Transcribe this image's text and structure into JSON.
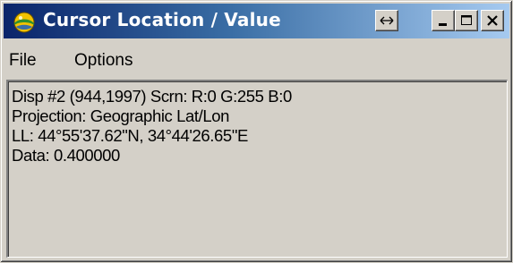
{
  "window": {
    "title": "Cursor Location / Value",
    "app_icon": "envi-globe-icon",
    "controls": {
      "resize_icon": "horizontal-resize-icon",
      "minimize_icon": "minimize-icon",
      "maximize_icon": "maximize-icon",
      "close_icon": "close-icon"
    }
  },
  "menu": {
    "items": [
      {
        "label": "File"
      },
      {
        "label": "Options"
      }
    ]
  },
  "info": {
    "lines": [
      "Disp #2 (944,1997) Scrn: R:0 G:255 B:0",
      "Projection: Geographic Lat/Lon",
      "LL: 44°55'37.62\"N, 34°44'26.65\"E",
      "Data: 0.400000"
    ]
  },
  "colors": {
    "titlebar_start": "#0a246a",
    "titlebar_end": "#a6caf0",
    "face": "#d4d0c8"
  }
}
